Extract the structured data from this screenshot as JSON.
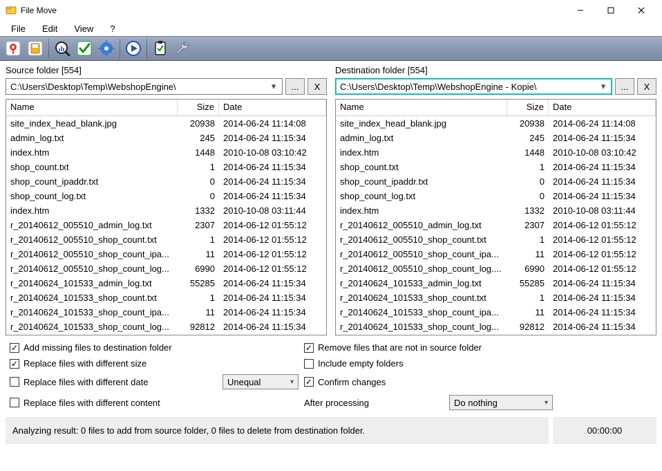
{
  "window": {
    "title": "File Move"
  },
  "menu": {
    "items": [
      "File",
      "Edit",
      "View",
      "?"
    ]
  },
  "source": {
    "label": "Source folder [554]",
    "path": "C:\\Users\\Desktop\\Temp\\WebshopEngine\\",
    "browse": "...",
    "clear": "X"
  },
  "dest": {
    "label": "Destination folder [554]",
    "path": "C:\\Users\\Desktop\\Temp\\WebshopEngine - Kopie\\",
    "browse": "...",
    "clear": "X"
  },
  "columns": {
    "name": "Name",
    "size": "Size",
    "date": "Date"
  },
  "files": [
    {
      "name": "site_index_head_blank.jpg",
      "size": "20938",
      "date": "2014-06-24 11:14:08"
    },
    {
      "name": "admin_log.txt",
      "size": "245",
      "date": "2014-06-24 11:15:34"
    },
    {
      "name": "index.htm",
      "size": "1448",
      "date": "2010-10-08 03:10:42"
    },
    {
      "name": "shop_count.txt",
      "size": "1",
      "date": "2014-06-24 11:15:34"
    },
    {
      "name": "shop_count_ipaddr.txt",
      "size": "0",
      "date": "2014-06-24 11:15:34"
    },
    {
      "name": "shop_count_log.txt",
      "size": "0",
      "date": "2014-06-24 11:15:34"
    },
    {
      "name": "index.htm",
      "size": "1332",
      "date": "2010-10-08 03:11:44"
    },
    {
      "name": "r_20140612_005510_admin_log.txt",
      "size": "2307",
      "date": "2014-06-12 01:55:12"
    },
    {
      "name": "r_20140612_005510_shop_count.txt",
      "size": "1",
      "date": "2014-06-12 01:55:12"
    },
    {
      "name": "r_20140612_005510_shop_count_ipa...",
      "size": "11",
      "date": "2014-06-12 01:55:12"
    },
    {
      "name": "r_20140612_005510_shop_count_log...",
      "size": "6990",
      "date": "2014-06-12 01:55:12"
    },
    {
      "name": "r_20140624_101533_admin_log.txt",
      "size": "55285",
      "date": "2014-06-24 11:15:34"
    },
    {
      "name": "r_20140624_101533_shop_count.txt",
      "size": "1",
      "date": "2014-06-24 11:15:34"
    },
    {
      "name": "r_20140624_101533_shop_count_ipa...",
      "size": "11",
      "date": "2014-06-24 11:15:34"
    },
    {
      "name": "r_20140624_101533_shop_count_log...",
      "size": "92812",
      "date": "2014-06-24 11:15:34"
    }
  ],
  "dest_files": [
    {
      "name": "site_index_head_blank.jpg",
      "size": "20938",
      "date": "2014-06-24 11:14:08"
    },
    {
      "name": "admin_log.txt",
      "size": "245",
      "date": "2014-06-24 11:15:34"
    },
    {
      "name": "index.htm",
      "size": "1448",
      "date": "2010-10-08 03:10:42"
    },
    {
      "name": "shop_count.txt",
      "size": "1",
      "date": "2014-06-24 11:15:34"
    },
    {
      "name": "shop_count_ipaddr.txt",
      "size": "0",
      "date": "2014-06-24 11:15:34"
    },
    {
      "name": "shop_count_log.txt",
      "size": "0",
      "date": "2014-06-24 11:15:34"
    },
    {
      "name": "index.htm",
      "size": "1332",
      "date": "2010-10-08 03:11:44"
    },
    {
      "name": "r_20140612_005510_admin_log.txt",
      "size": "2307",
      "date": "2014-06-12 01:55:12"
    },
    {
      "name": "r_20140612_005510_shop_count.txt",
      "size": "1",
      "date": "2014-06-12 01:55:12"
    },
    {
      "name": "r_20140612_005510_shop_count_ipa...",
      "size": "11",
      "date": "2014-06-12 01:55:12"
    },
    {
      "name": "r_20140612_005510_shop_count_log....",
      "size": "6990",
      "date": "2014-06-12 01:55:12"
    },
    {
      "name": "r_20140624_101533_admin_log.txt",
      "size": "55285",
      "date": "2014-06-24 11:15:34"
    },
    {
      "name": "r_20140624_101533_shop_count.txt",
      "size": "1",
      "date": "2014-06-24 11:15:34"
    },
    {
      "name": "r_20140624_101533_shop_count_ipa...",
      "size": "11",
      "date": "2014-06-24 11:15:34"
    },
    {
      "name": "r_20140624_101533_shop_count_log...",
      "size": "92812",
      "date": "2014-06-24 11:15:34"
    }
  ],
  "opts": {
    "add_missing": "Add missing files to destination folder",
    "remove_not_in_source": "Remove files that are not in source folder",
    "replace_size": "Replace files with different size",
    "include_empty": "Include empty folders",
    "replace_date": "Replace files with different date",
    "date_mode": "Unequal",
    "confirm": "Confirm changes",
    "replace_content": "Replace files with different content",
    "after_label": "After processing",
    "after_value": "Do nothing"
  },
  "status": {
    "text": "Analyzing result: 0 files to add from source folder, 0 files to delete from destination folder.",
    "time": "00:00:00"
  }
}
